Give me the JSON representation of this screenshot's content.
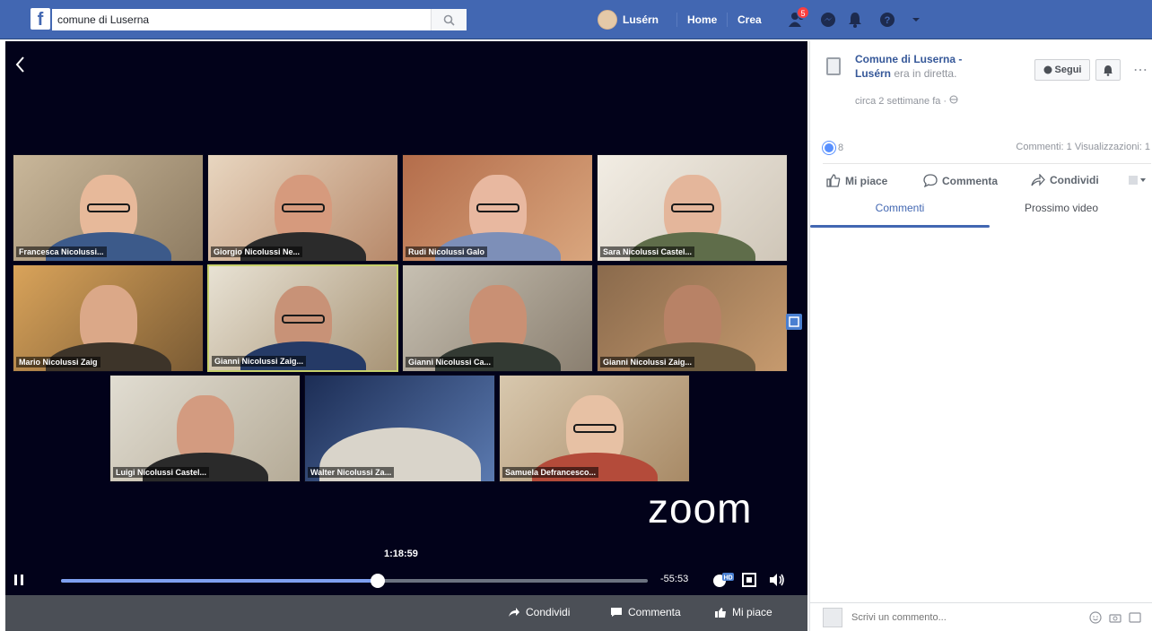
{
  "topbar": {
    "search_value": "comune di Luserna",
    "user_name": "Lusérn",
    "home_label": "Home",
    "create_label": "Crea",
    "friend_requests_count": "5"
  },
  "video": {
    "participants": [
      {
        "name": "Francesca Nicolussi..."
      },
      {
        "name": "Giorgio Nicolussi Ne..."
      },
      {
        "name": "Rudi Nicolussi Galo"
      },
      {
        "name": "Sara Nicolussi Castel..."
      },
      {
        "name": "Mario Nicolussi Zaig"
      },
      {
        "name": "Gianni Nicolussi Zaig..."
      },
      {
        "name": "Gianni Nicolussi Ca..."
      },
      {
        "name": "Gianni Nicolussi Zaig..."
      },
      {
        "name": "Luigi Nicolussi Castel..."
      },
      {
        "name": "Walter Nicolussi Za..."
      },
      {
        "name": "Samuela Defrancesco..."
      }
    ],
    "zoom_logo": "zoom",
    "current_time": "1:18:59",
    "remaining_time": "-55:53",
    "progress": 0.54,
    "bottom_actions": {
      "share": "Condividi",
      "comment": "Commenta",
      "like": "Mi piace"
    }
  },
  "side": {
    "page_name": "Comune di Luserna - Lusérn",
    "live_text": "era in diretta.",
    "meta": "circa 2 settimane fa ·",
    "follow_label": "Segui",
    "reaction_count": "8",
    "stats": "Commenti: 1 Visualizzazioni: 1",
    "actions": {
      "like": "Mi piace",
      "comment": "Commenta",
      "share": "Condividi"
    },
    "tabs": {
      "comments": "Commenti",
      "next_video": "Prossimo video"
    },
    "comment_placeholder": "Scrivi un commento..."
  },
  "colors": {
    "facebook_blue": "#4267b2",
    "video_bg": "#02021a",
    "active_speaker_border": "#c6cf6a"
  }
}
